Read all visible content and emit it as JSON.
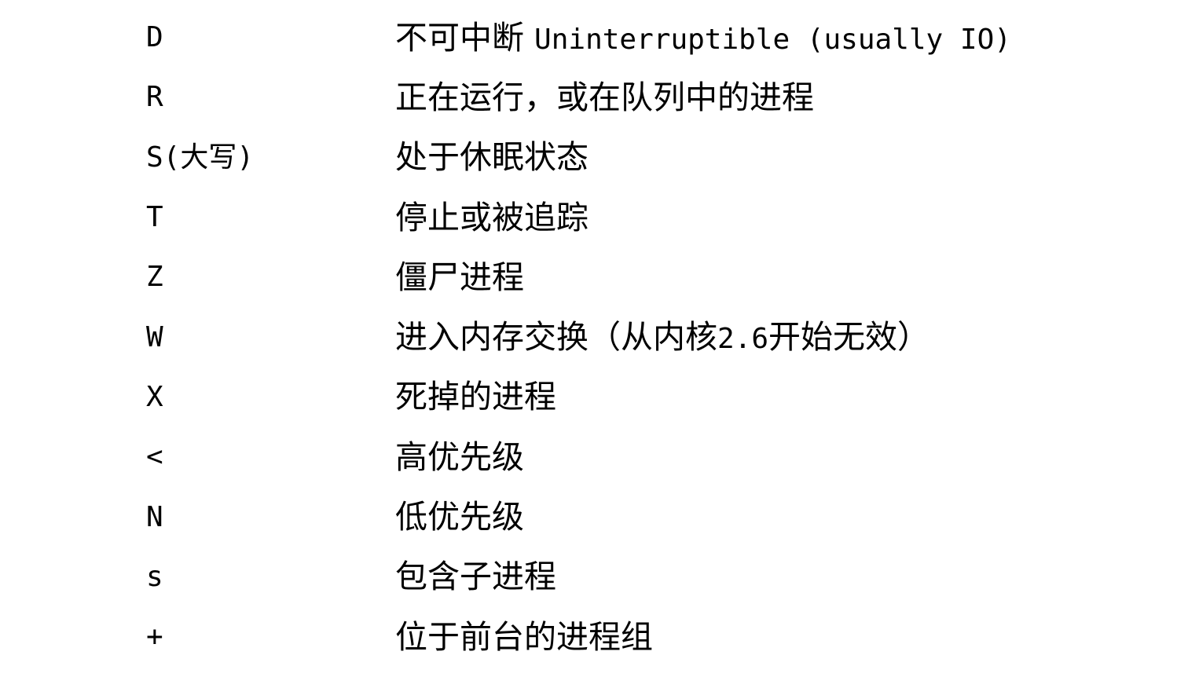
{
  "states": [
    {
      "code": "D",
      "desc_cn": "不可中断 ",
      "desc_mono": "Uninterruptible (usually IO)",
      "desc_tail": ""
    },
    {
      "code": "R",
      "desc_cn": "正在运行，或在队列中的进程",
      "desc_mono": "",
      "desc_tail": ""
    },
    {
      "code": "S(大写)",
      "desc_cn": "处于休眠状态",
      "desc_mono": "",
      "desc_tail": ""
    },
    {
      "code": "T",
      "desc_cn": "停止或被追踪",
      "desc_mono": "",
      "desc_tail": ""
    },
    {
      "code": "Z",
      "desc_cn": "僵尸进程",
      "desc_mono": "",
      "desc_tail": ""
    },
    {
      "code": "W",
      "desc_cn": "进入内存交换（从内核",
      "desc_mono": "2.6",
      "desc_tail": "开始无效）"
    },
    {
      "code": "X",
      "desc_cn": "死掉的进程",
      "desc_mono": "",
      "desc_tail": ""
    },
    {
      "code": "<",
      "desc_cn": "高优先级",
      "desc_mono": "",
      "desc_tail": ""
    },
    {
      "code": "N",
      "desc_cn": "低优先级",
      "desc_mono": "",
      "desc_tail": ""
    },
    {
      "code": "s",
      "desc_cn": "包含子进程",
      "desc_mono": "",
      "desc_tail": ""
    },
    {
      "code": "+",
      "desc_cn": "位于前台的进程组",
      "desc_mono": "",
      "desc_tail": ""
    }
  ]
}
